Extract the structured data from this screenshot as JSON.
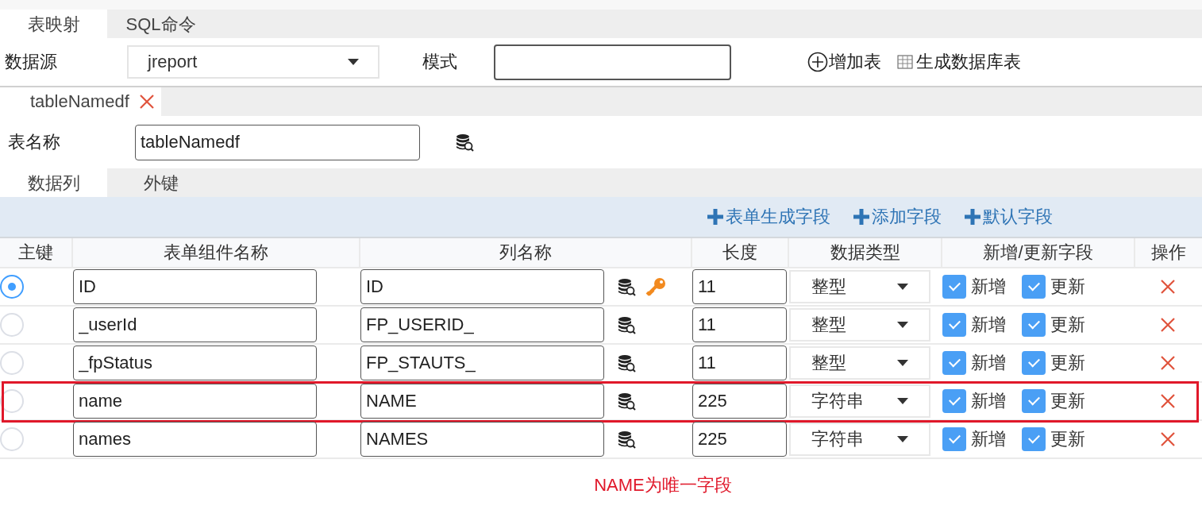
{
  "main_tabs": [
    {
      "label": "表映射",
      "selected": true
    },
    {
      "label": "SQL命令",
      "selected": false
    }
  ],
  "form": {
    "datasource_label": "数据源",
    "datasource_value": "jreport",
    "mode_label": "模式",
    "add_table": "增加表",
    "generate_table": "生成数据库表"
  },
  "table_tabs": [
    {
      "label": "tableNamedf",
      "selected": true
    }
  ],
  "table_name": {
    "label": "表名称",
    "value": "tableNamedf"
  },
  "sub_tabs": [
    {
      "label": "数据列",
      "selected": true
    },
    {
      "label": "外键",
      "selected": false
    }
  ],
  "toolbar": [
    "表单生成字段",
    "添加字段",
    "默认字段"
  ],
  "columns": [
    "主键",
    "表单组件名称",
    "列名称",
    "长度",
    "数据类型",
    "新增/更新字段",
    "操作"
  ],
  "rows": [
    {
      "primary": true,
      "form_name": "ID",
      "column_name": "ID",
      "key": true,
      "length": "11",
      "type": "整型",
      "insert": true,
      "insert_label": "新增",
      "update": true,
      "update_label": "更新",
      "highlighted": false
    },
    {
      "primary": false,
      "form_name": "_userId",
      "column_name": "FP_USERID_",
      "key": false,
      "length": "11",
      "type": "整型",
      "insert": true,
      "insert_label": "新增",
      "update": true,
      "update_label": "更新",
      "highlighted": false
    },
    {
      "primary": false,
      "form_name": "_fpStatus",
      "column_name": "FP_STAUTS_",
      "key": false,
      "length": "11",
      "type": "整型",
      "insert": true,
      "insert_label": "新增",
      "update": true,
      "update_label": "更新",
      "highlighted": false
    },
    {
      "primary": false,
      "form_name": "name",
      "column_name": "NAME",
      "key": false,
      "length": "225",
      "type": "字符串",
      "insert": true,
      "insert_label": "新增",
      "update": true,
      "update_label": "更新",
      "highlighted": true
    },
    {
      "primary": false,
      "form_name": "names",
      "column_name": "NAMES",
      "key": false,
      "length": "225",
      "type": "字符串",
      "insert": true,
      "insert_label": "新增",
      "update": true,
      "update_label": "更新",
      "highlighted": false
    }
  ],
  "annotation": "NAME为唯一字段"
}
